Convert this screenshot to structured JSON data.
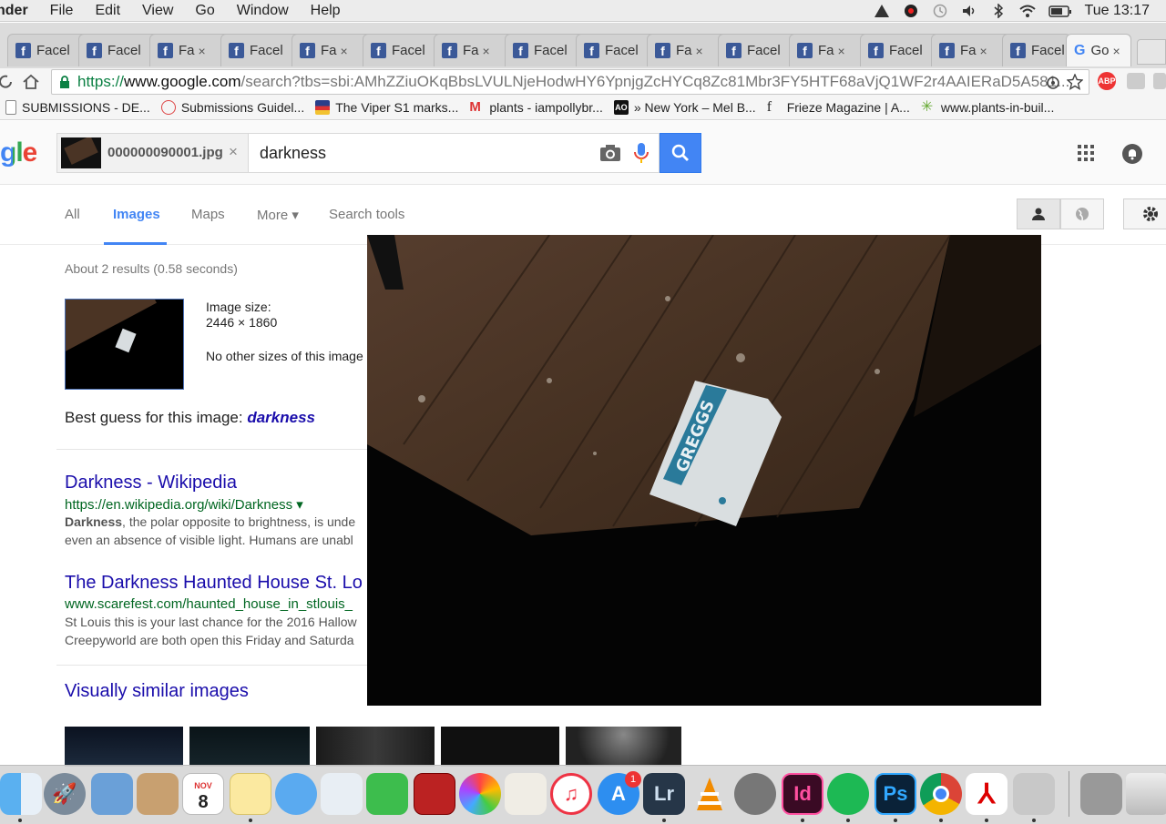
{
  "menubar": {
    "app": "nder",
    "items": [
      "File",
      "Edit",
      "View",
      "Go",
      "Window",
      "Help"
    ],
    "clock": "Tue 13:17"
  },
  "tabs": {
    "facebook_label": "Facel",
    "facebook_short": "Fa",
    "close": "×",
    "google_label": "Go",
    "fb_glyph": "f",
    "g_glyph": "G"
  },
  "omnibox": {
    "scheme": "https://",
    "host": "www.google.com",
    "path": "/search?tbs=sbi:AMhZZiuOKqBbsLVULNjeHodwHY6YpnjgZcHYCq8Zc81Mbr3FY5HTF68aVjQ1WF2r4AAIERaD5A581..."
  },
  "bookmarks": [
    {
      "label": "SUBMISSIONS - DE..."
    },
    {
      "label": "Submissions Guidel..."
    },
    {
      "label": "The Viper S1 marks..."
    },
    {
      "label": "plants - iampollybr..."
    },
    {
      "label": "» New York – Mel B..."
    },
    {
      "label": "Frieze Magazine | A..."
    },
    {
      "label": "www.plants-in-buil..."
    }
  ],
  "search": {
    "logo": "gle",
    "chip_filename": "000000090001.jpg",
    "chip_close": "×",
    "query": "darkness"
  },
  "nav": {
    "all": "All",
    "images": "Images",
    "maps": "Maps",
    "more": "More ▾",
    "search_tools": "Search tools"
  },
  "results": {
    "stats": "About 2 results (0.58 seconds)",
    "image_size_label": "Image size:",
    "image_size": "2446 × 1860",
    "no_other_sizes": "No other sizes of this image",
    "best_guess_label": "Best guess for this image:",
    "best_guess": "darkness",
    "items": [
      {
        "title": "Darkness - Wikipedia",
        "url": "https://en.wikipedia.org/wiki/Darkness ▾",
        "snippet_bold": "Darkness",
        "snippet_1": ", the polar opposite to brightness, is unde",
        "snippet_2": "even an absence of visible light. Humans are unabl"
      },
      {
        "title": "The Darkness Haunted House St. Lo",
        "url": "www.scarefest.com/haunted_house_in_stlouis_",
        "snippet_1": "St Louis this is your last chance for the 2016 Hallow",
        "snippet_2": "Creepyworld are both open this Friday and Saturda"
      }
    ],
    "visually_similar": "Visually similar images"
  },
  "overlay_image": {
    "bag_text": "GREGGS"
  },
  "dock": {
    "calendar_month": "NOV",
    "calendar_day": "8",
    "appstore_badge": "1",
    "lr": "Lr",
    "id": "Id",
    "ps": "Ps"
  }
}
